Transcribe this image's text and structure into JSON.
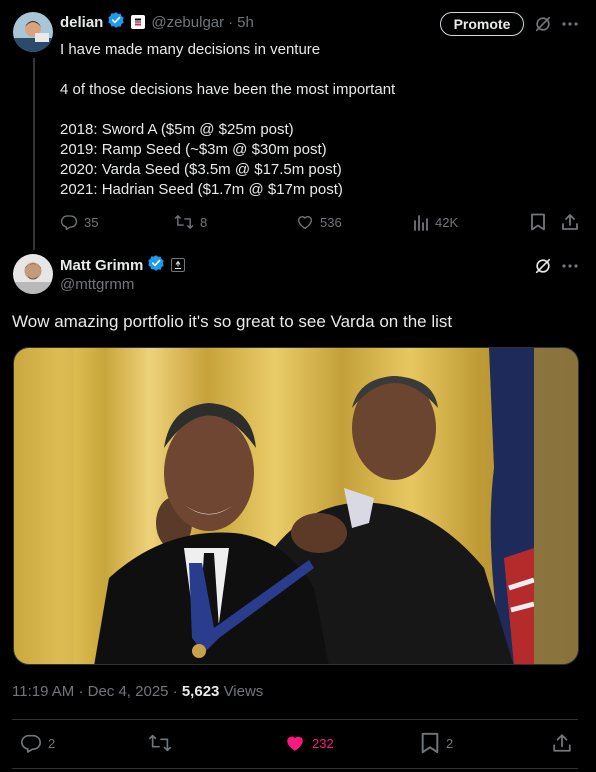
{
  "original": {
    "author_name": "delian",
    "handle": "@zebulgar",
    "dot": "·",
    "time": "5h",
    "promote_label": "Promote",
    "lines": [
      "I have made many decisions in venture",
      "4 of those decisions have been the most important",
      "2018: Sword A ($5m @ $25m post)",
      "2019: Ramp Seed (~$3m @ $30m post)",
      "2020: Varda Seed ($3.5m @ $17.5m post)",
      "2021: Hadrian Seed ($1.7m @ $17m post)"
    ],
    "replies": "35",
    "reposts": "8",
    "likes": "536",
    "views": "42K"
  },
  "reply": {
    "author_name": "Matt Grimm",
    "handle": "@mttgrmm",
    "text": "Wow amazing portfolio it's so great to see Varda on the list",
    "time": "11:19 AM",
    "dot": "·",
    "date": "Dec 4, 2025",
    "dot2": "·",
    "views_count": "5,623",
    "views_label": "Views",
    "replies": "2",
    "likes": "232",
    "bookmarks": "2"
  },
  "colors": {
    "accent": "#1d9bf0",
    "like": "#f91880",
    "muted": "#71767b",
    "text": "#e7e9ea",
    "background": "#000000"
  },
  "icons": [
    "verified-badge-icon",
    "affiliate-badge-icon",
    "grok-icon",
    "more-icon",
    "reply-icon",
    "repost-icon",
    "like-icon",
    "views-icon",
    "bookmark-icon",
    "share-icon"
  ]
}
